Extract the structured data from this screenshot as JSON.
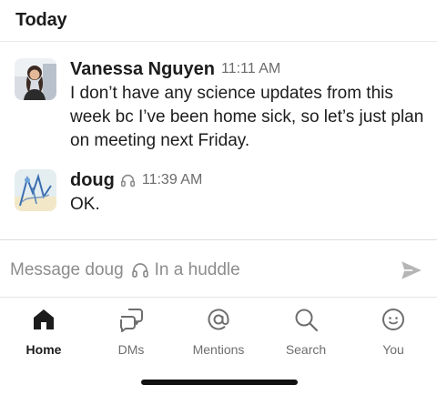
{
  "day_header": "Today",
  "messages": [
    {
      "sender": "Vanessa Nguyen",
      "time": "11:11 AM",
      "text": "I don’t have any science updates from this week bc I’ve been home sick, so let’s just plan on meeting next Friday."
    },
    {
      "sender": "doug",
      "status_icon": "headphones-icon",
      "time": "11:39 AM",
      "text": "OK."
    }
  ],
  "composer": {
    "placeholder": "Message doug",
    "status_icon": "headphones-icon",
    "status_text": "In a huddle",
    "send_icon": "send-icon"
  },
  "tabs": [
    {
      "label": "Home",
      "icon": "home-icon",
      "active": true
    },
    {
      "label": "DMs",
      "icon": "dms-icon",
      "active": false
    },
    {
      "label": "Mentions",
      "icon": "mentions-icon",
      "active": false
    },
    {
      "label": "Search",
      "icon": "search-icon",
      "active": false
    },
    {
      "label": "You",
      "icon": "you-icon",
      "active": false
    }
  ],
  "colors": {
    "text": "#1d1c1d",
    "muted": "#6b6b6b",
    "placeholder": "#8c8c8c",
    "divider": "#e8e8e8"
  }
}
